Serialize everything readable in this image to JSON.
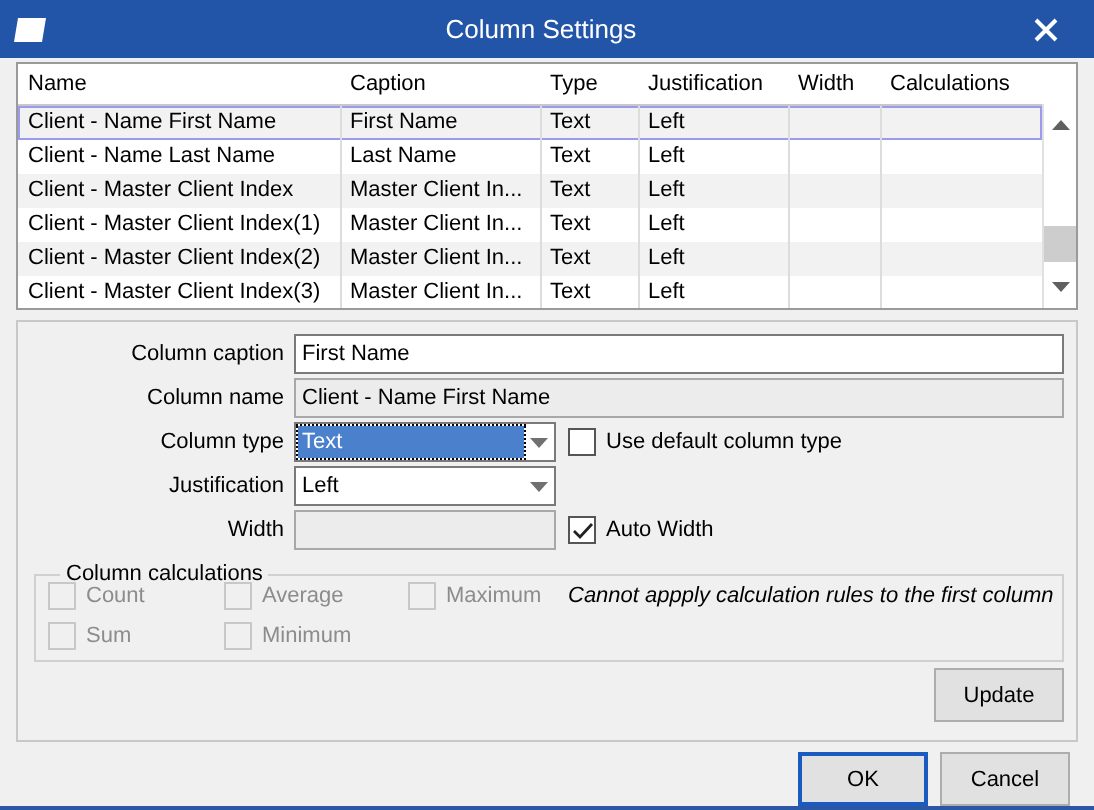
{
  "window": {
    "title": "Column Settings"
  },
  "table": {
    "columns": [
      "Name",
      "Caption",
      "Type",
      "Justification",
      "Width",
      "Calculations"
    ],
    "rows": [
      {
        "cells": [
          "Client - Name First Name",
          "First Name",
          "Text",
          "Left",
          "",
          ""
        ],
        "selected": true
      },
      {
        "cells": [
          "Client - Name Last Name",
          "Last Name",
          "Text",
          "Left",
          "",
          ""
        ],
        "selected": false
      },
      {
        "cells": [
          "Client - Master Client Index",
          "Master Client In...",
          "Text",
          "Left",
          "",
          ""
        ],
        "selected": false
      },
      {
        "cells": [
          "Client - Master Client Index(1)",
          "Master Client In...",
          "Text",
          "Left",
          "",
          ""
        ],
        "selected": false
      },
      {
        "cells": [
          "Client - Master Client Index(2)",
          "Master Client In...",
          "Text",
          "Left",
          "",
          ""
        ],
        "selected": false
      },
      {
        "cells": [
          "Client - Master Client Index(3)",
          "Master Client In...",
          "Text",
          "Left",
          "",
          ""
        ],
        "selected": false
      }
    ]
  },
  "form": {
    "caption": {
      "label": "Column caption",
      "value": "First Name"
    },
    "name": {
      "label": "Column name",
      "value": "Client - Name First Name"
    },
    "type": {
      "label": "Column type",
      "value": "Text",
      "focused": true
    },
    "default_type": {
      "label": "Use default column type",
      "checked": false
    },
    "justification": {
      "label": "Justification",
      "value": "Left"
    },
    "width": {
      "label": "Width"
    },
    "auto_width": {
      "label": "Auto Width",
      "checked": true
    }
  },
  "calculations": {
    "title": "Column calculations",
    "options": [
      {
        "label": "Count",
        "checked": false,
        "disabled": true
      },
      {
        "label": "Average",
        "checked": false,
        "disabled": true
      },
      {
        "label": "Maximum",
        "checked": false,
        "disabled": true
      },
      {
        "label": "Sum",
        "checked": false,
        "disabled": true
      },
      {
        "label": "Minimum",
        "checked": false,
        "disabled": true
      }
    ],
    "note": "Cannot appply calculation rules to the first column"
  },
  "buttons": {
    "update": "Update",
    "ok": "OK",
    "cancel": "Cancel"
  }
}
